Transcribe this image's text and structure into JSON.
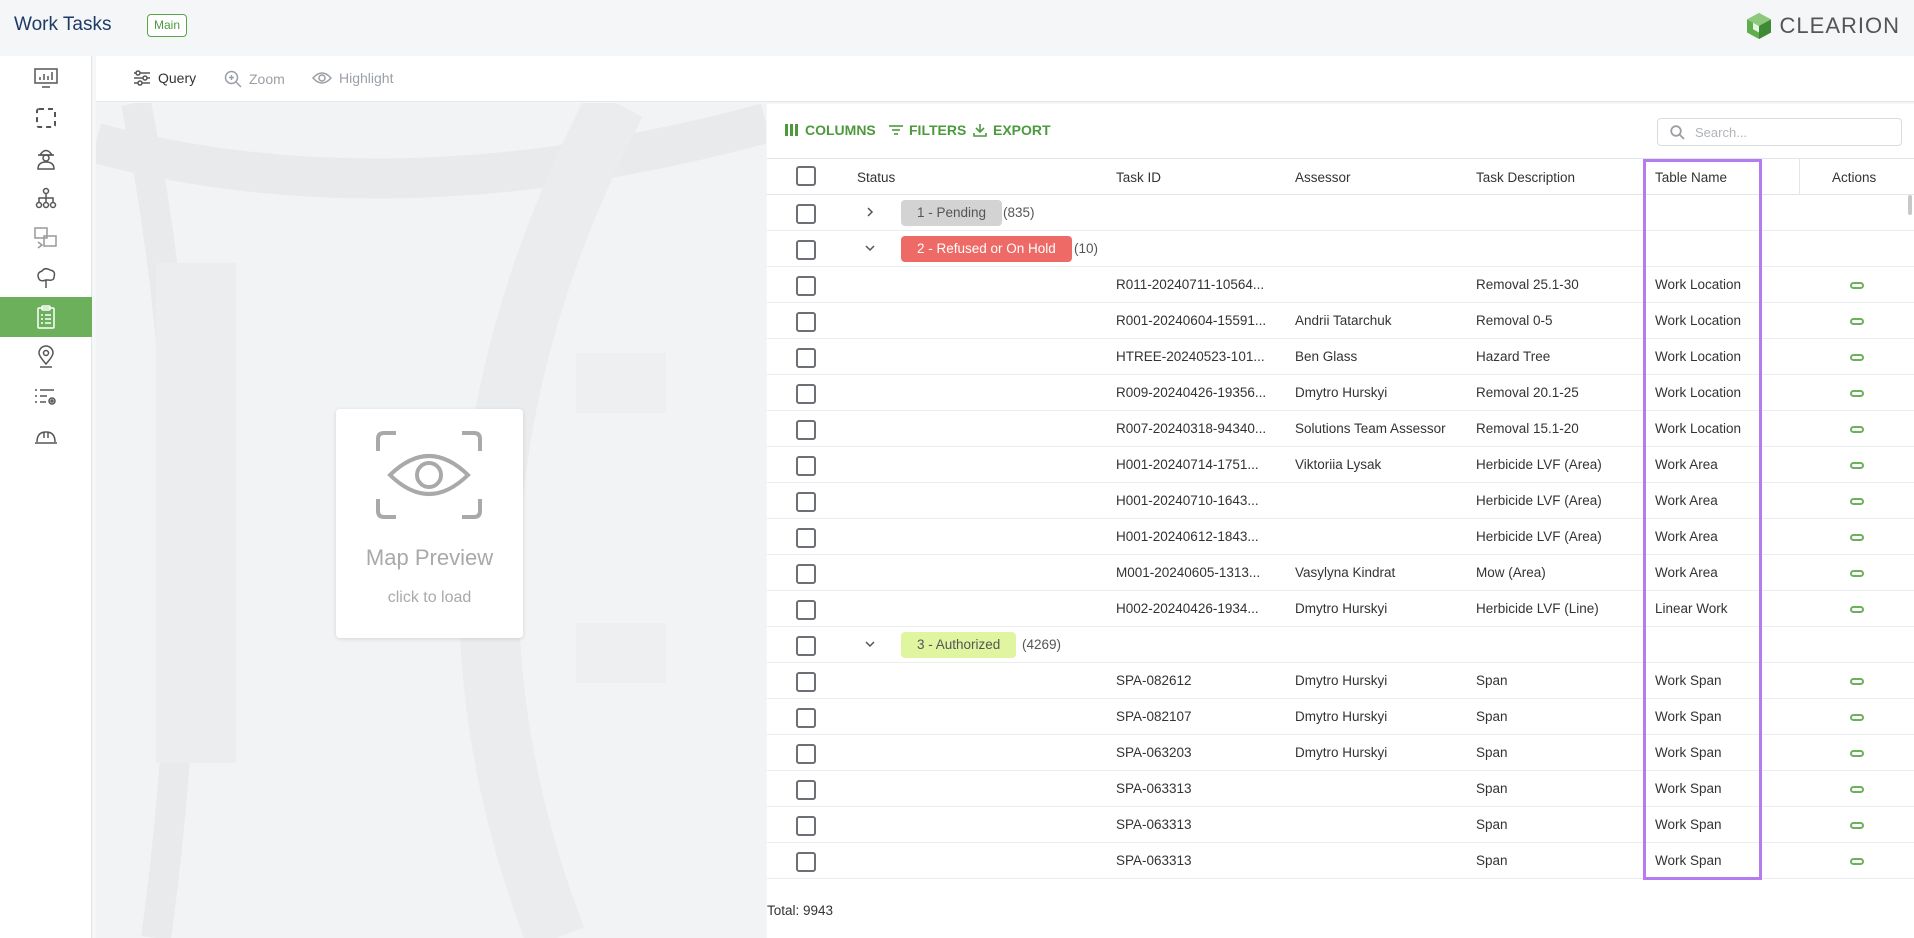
{
  "header": {
    "title": "Work Tasks",
    "badge": "Main",
    "brand": "CLEARION",
    "brand_color": "#4c9a3d"
  },
  "sidebar": {
    "items": [
      {
        "icon": "monitor-chart-icon"
      },
      {
        "icon": "dashed-square-icon"
      },
      {
        "icon": "worker-icon"
      },
      {
        "icon": "hierarchy-icon"
      },
      {
        "icon": "image-swap-icon"
      },
      {
        "icon": "tree-icon"
      },
      {
        "icon": "clipboard-list-icon",
        "active": true
      },
      {
        "icon": "map-pin-icon"
      },
      {
        "icon": "list-settings-icon"
      },
      {
        "icon": "hard-hat-icon"
      }
    ],
    "active_color": "#6cb05c"
  },
  "toolbar": {
    "query": "Query",
    "zoom": "Zoom",
    "highlight": "Highlight"
  },
  "map": {
    "title": "Map Preview",
    "subtitle": "click to load"
  },
  "table": {
    "tools": {
      "columns": "COLUMNS",
      "filters": "FILTERS",
      "export": "EXPORT"
    },
    "search_placeholder": "Search...",
    "headers": {
      "status": "Status",
      "task_id": "Task ID",
      "assessor": "Assessor",
      "description": "Task Description",
      "table_name": "Table Name",
      "actions": "Actions"
    },
    "groups": [
      {
        "label": "1 - Pending",
        "count": "(835)",
        "expanded": false,
        "bg": "#d3d3d3",
        "fg": "#555555"
      },
      {
        "label": "2 - Refused or On Hold",
        "count": "(10)",
        "expanded": true,
        "bg": "#ee6a66",
        "fg": "#ffffff"
      },
      {
        "label": "3 - Authorized",
        "count": "(4269)",
        "expanded": true,
        "bg": "#dff5a0",
        "fg": "#555555"
      }
    ],
    "refused_rows": [
      {
        "task_id": "R011-20240711-10564...",
        "assessor": "",
        "description": "Removal 25.1-30",
        "table_name": "Work Location"
      },
      {
        "task_id": "R001-20240604-15591...",
        "assessor": "Andrii Tatarchuk",
        "description": "Removal 0-5",
        "table_name": "Work Location"
      },
      {
        "task_id": "HTREE-20240523-101...",
        "assessor": "Ben Glass",
        "description": "Hazard Tree",
        "table_name": "Work Location"
      },
      {
        "task_id": "R009-20240426-19356...",
        "assessor": "Dmytro Hurskyi",
        "description": "Removal 20.1-25",
        "table_name": "Work Location"
      },
      {
        "task_id": "R007-20240318-94340...",
        "assessor": "Solutions Team Assessor",
        "description": "Removal 15.1-20",
        "table_name": "Work Location"
      },
      {
        "task_id": "H001-20240714-1751...",
        "assessor": "Viktoriia Lysak",
        "description": "Herbicide LVF (Area)",
        "table_name": "Work Area"
      },
      {
        "task_id": "H001-20240710-1643...",
        "assessor": "",
        "description": "Herbicide LVF (Area)",
        "table_name": "Work Area"
      },
      {
        "task_id": "H001-20240612-1843...",
        "assessor": "",
        "description": "Herbicide LVF (Area)",
        "table_name": "Work Area"
      },
      {
        "task_id": "M001-20240605-1313...",
        "assessor": "Vasylyna Kindrat",
        "description": "Mow (Area)",
        "table_name": "Work Area"
      },
      {
        "task_id": "H002-20240426-1934...",
        "assessor": "Dmytro Hurskyi",
        "description": "Herbicide LVF (Line)",
        "table_name": "Linear Work"
      }
    ],
    "authorized_rows": [
      {
        "task_id": "SPA-082612",
        "assessor": "Dmytro Hurskyi",
        "description": "Span",
        "table_name": "Work Span"
      },
      {
        "task_id": "SPA-082107",
        "assessor": "Dmytro Hurskyi",
        "description": "Span",
        "table_name": "Work Span"
      },
      {
        "task_id": "SPA-063203",
        "assessor": "Dmytro Hurskyi",
        "description": "Span",
        "table_name": "Work Span"
      },
      {
        "task_id": "SPA-063313",
        "assessor": "",
        "description": "Span",
        "table_name": "Work Span"
      },
      {
        "task_id": "SPA-063313",
        "assessor": "",
        "description": "Span",
        "table_name": "Work Span"
      },
      {
        "task_id": "SPA-063313",
        "assessor": "",
        "description": "Span",
        "table_name": "Work Span"
      }
    ],
    "total": "Total: 9943",
    "highlight_color": "#b57cf0"
  }
}
